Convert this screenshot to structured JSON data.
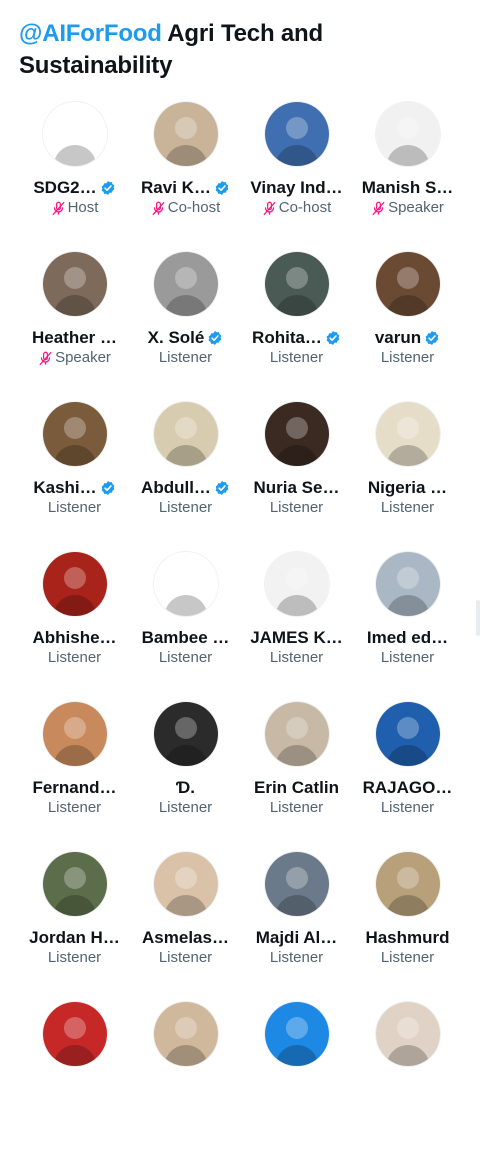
{
  "space": {
    "host_handle": "@AIForFood",
    "title_rest": " Agri Tech and Sustainability"
  },
  "colors": {
    "accent": "#1d9bf0",
    "muted_mic": "#f91880",
    "secondary_text": "#536471"
  },
  "participants": [
    {
      "name": "SDG2…",
      "verified": true,
      "role": "Host",
      "muted": true,
      "bg": "#ffffff"
    },
    {
      "name": "Ravi K…",
      "verified": true,
      "role": "Co-host",
      "muted": true,
      "bg": "#c9b49a"
    },
    {
      "name": "Vinay Ind…",
      "verified": false,
      "role": "Co-host",
      "muted": true,
      "bg": "#3f6fb0"
    },
    {
      "name": "Manish S…",
      "verified": false,
      "role": "Speaker",
      "muted": true,
      "bg": "#f1f1f1"
    },
    {
      "name": "Heather …",
      "verified": false,
      "role": "Speaker",
      "muted": true,
      "bg": "#7d6a5a"
    },
    {
      "name": "X. Solé",
      "verified": true,
      "role": "Listener",
      "muted": false,
      "bg": "#9a9a9a"
    },
    {
      "name": "Rohita…",
      "verified": true,
      "role": "Listener",
      "muted": false,
      "bg": "#4a5a55"
    },
    {
      "name": "varun",
      "verified": true,
      "role": "Listener",
      "muted": false,
      "bg": "#6b4a34"
    },
    {
      "name": "Kashi…",
      "verified": true,
      "role": "Listener",
      "muted": false,
      "bg": "#7a5c3c"
    },
    {
      "name": "Abdull…",
      "verified": true,
      "role": "Listener",
      "muted": false,
      "bg": "#d8ccb0"
    },
    {
      "name": "Nuria Se…",
      "verified": false,
      "role": "Listener",
      "muted": false,
      "bg": "#3a2a22"
    },
    {
      "name": "Nigeria …",
      "verified": false,
      "role": "Listener",
      "muted": false,
      "bg": "#e6ddc9"
    },
    {
      "name": "Abhishe…",
      "verified": false,
      "role": "Listener",
      "muted": false,
      "bg": "#a8231a"
    },
    {
      "name": "Bambee …",
      "verified": false,
      "role": "Listener",
      "muted": false,
      "bg": "#ffffff"
    },
    {
      "name": "JAMES K…",
      "verified": false,
      "role": "Listener",
      "muted": false,
      "bg": "#f2f2f2"
    },
    {
      "name": "Imed ed…",
      "verified": false,
      "role": "Listener",
      "muted": false,
      "bg": "#a9b8c4"
    },
    {
      "name": "Fernand…",
      "verified": false,
      "role": "Listener",
      "muted": false,
      "bg": "#c88a5c"
    },
    {
      "name": "Ɗ.",
      "verified": false,
      "role": "Listener",
      "muted": false,
      "bg": "#2b2b2b"
    },
    {
      "name": "Erin Catlin",
      "verified": false,
      "role": "Listener",
      "muted": false,
      "bg": "#c7b9a6"
    },
    {
      "name": "RAJAGO…",
      "verified": false,
      "role": "Listener",
      "muted": false,
      "bg": "#1f5fae"
    },
    {
      "name": "Jordan H…",
      "verified": false,
      "role": "Listener",
      "muted": false,
      "bg": "#5b6d4a"
    },
    {
      "name": "Asmelas…",
      "verified": false,
      "role": "Listener",
      "muted": false,
      "bg": "#d9c2a8"
    },
    {
      "name": "Majdi Al…",
      "verified": false,
      "role": "Listener",
      "muted": false,
      "bg": "#6b7a8a"
    },
    {
      "name": "Hashmurd",
      "verified": false,
      "role": "Listener",
      "muted": false,
      "bg": "#b8a07a"
    },
    {
      "name": "",
      "verified": false,
      "role": "",
      "muted": false,
      "bg": "#c62828"
    },
    {
      "name": "",
      "verified": false,
      "role": "",
      "muted": false,
      "bg": "#d0b89c"
    },
    {
      "name": "",
      "verified": false,
      "role": "",
      "muted": false,
      "bg": "#1e88e5"
    },
    {
      "name": "",
      "verified": false,
      "role": "",
      "muted": false,
      "bg": "#e0d2c4"
    }
  ]
}
